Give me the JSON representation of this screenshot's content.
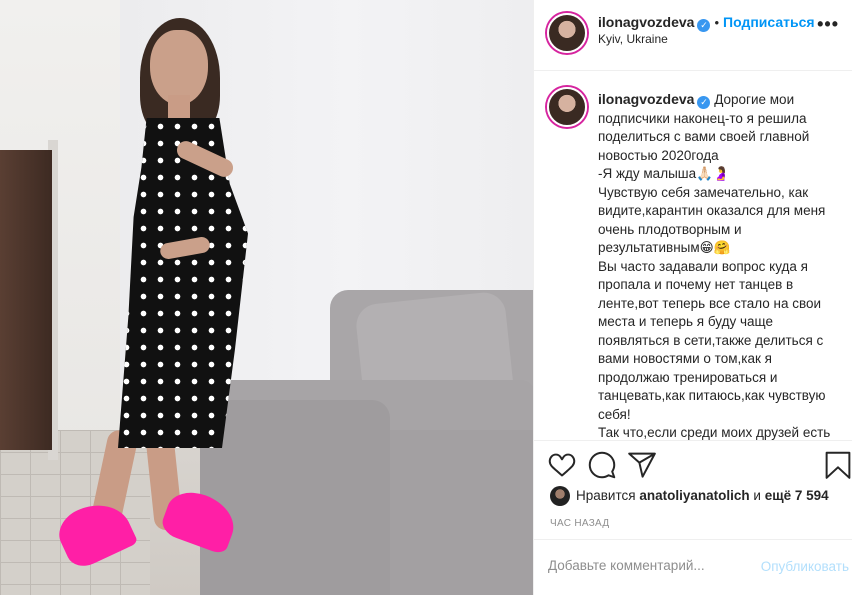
{
  "post": {
    "username": "ilonagvozdeva",
    "verified_icon": "verified-badge-icon",
    "follow_label": "Подписаться",
    "dot": "•",
    "location": "Kyiv, Ukraine",
    "more_label": "•••"
  },
  "caption": {
    "username": "ilonagvozdeva",
    "lines": [
      "Дорогие мои подписчики наконец-то я решила поделиться с вами своей главной новостью 2020года",
      "-Я жду малыша🙏🏻🤰",
      "Чувствую себя замечательно, как видите,карантин оказался для меня очень плодотворным и результативным😁🤗",
      "Вы часто задавали вопрос куда я пропала и почему нет танцев в ленте,вот теперь все стало на свои места и теперь я буду чаще появляться в сети,также делиться с вами новостями о том,как я продолжаю тренироваться и танцевать,как питаюсь,как чувствую себя!",
      "Так что,если среди моих друзей есть"
    ]
  },
  "actions": {
    "like_icon": "heart-icon",
    "comment_icon": "comment-icon",
    "share_icon": "share-icon",
    "save_icon": "bookmark-icon"
  },
  "likes": {
    "prefix": "Нравится",
    "user": "anatoliyanatolich",
    "middle": "и",
    "rest": "ещё 7 594"
  },
  "time": "ЧАС НАЗАД",
  "comment": {
    "placeholder": "Добавьте комментарий...",
    "publish_label": "Опубликовать"
  },
  "colors": {
    "accent": "#0095f6",
    "verified": "#3897f0",
    "publish_disabled": "#b2dffc",
    "shoes": "#ff1fa6"
  }
}
